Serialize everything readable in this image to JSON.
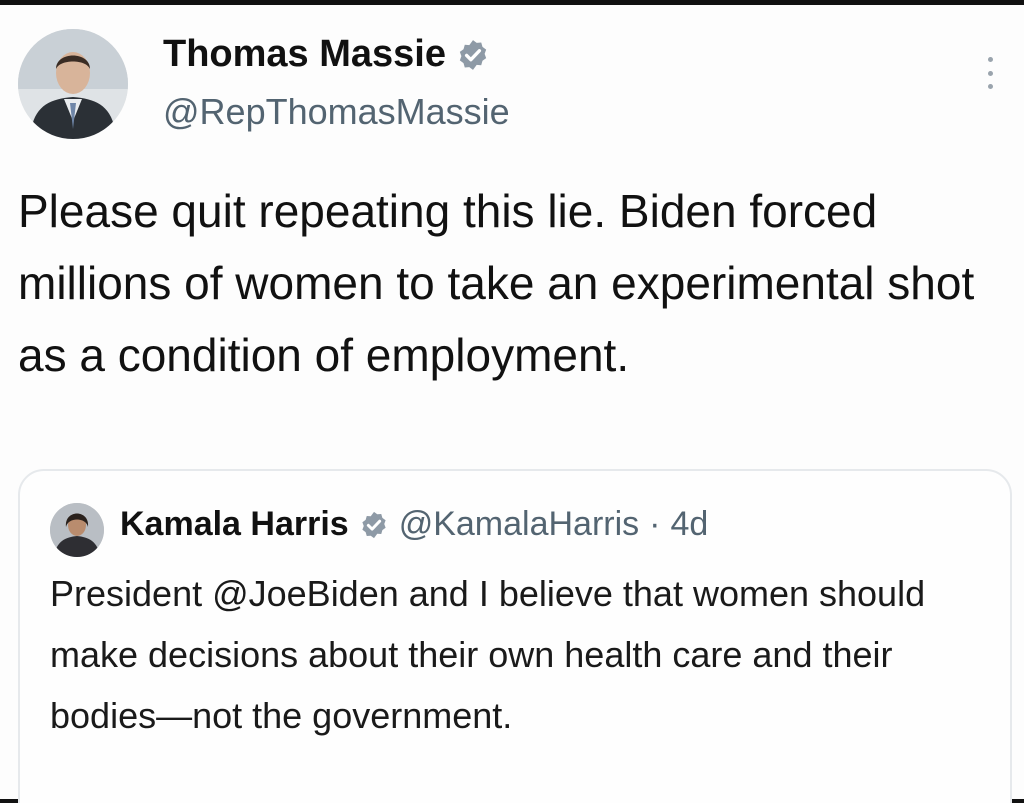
{
  "tweet": {
    "author_name": "Thomas Massie",
    "author_handle": "@RepThomasMassie",
    "verified_icon": "verified-badge-icon",
    "text": "Please quit repeating this lie. Biden forced millions of women to take an experimental shot as a condition of employment.",
    "more_icon": "more-options-icon"
  },
  "quoted_tweet": {
    "author_name": "Kamala Harris",
    "author_handle": "@KamalaHarris",
    "separator": "·",
    "time": "4d",
    "text": "President @JoeBiden and I believe that women should make decisions about their own health care and their bodies—not the government."
  },
  "colors": {
    "text": "#0f1419",
    "secondary_text": "#536471",
    "card_border": "#e6e9ec",
    "verified_badge": "#8e9aa6"
  }
}
